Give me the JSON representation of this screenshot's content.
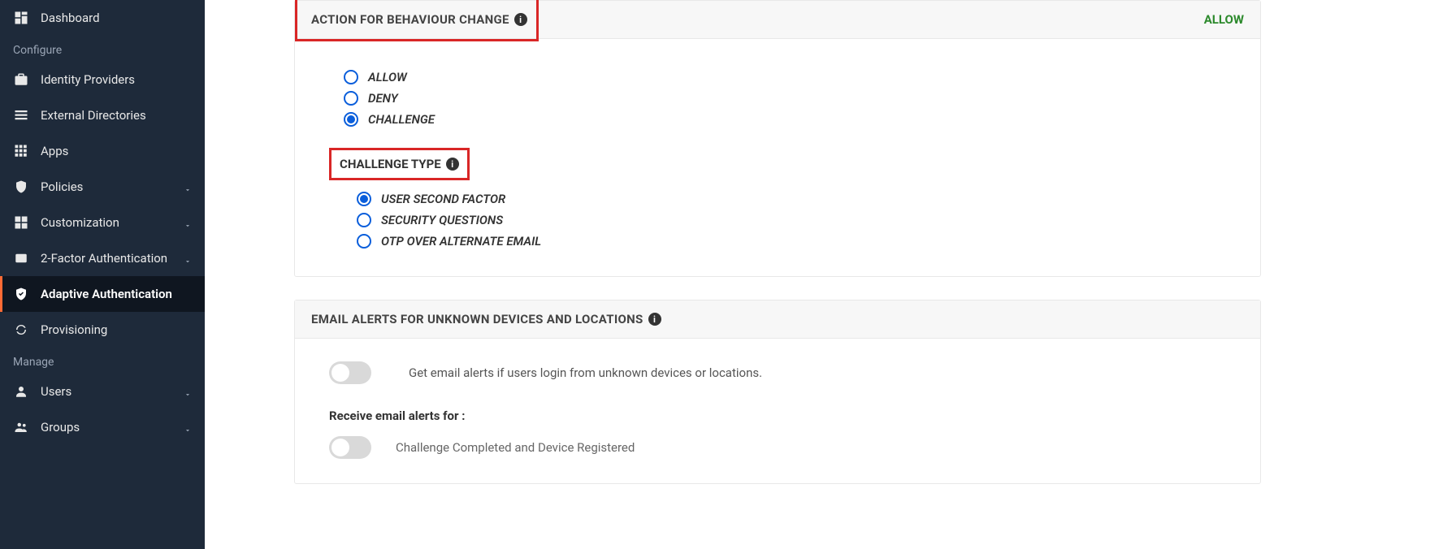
{
  "sidebar": {
    "items": [
      {
        "label": "Dashboard",
        "icon": "dashboard"
      }
    ],
    "sections": [
      {
        "label": "Configure",
        "items": [
          {
            "label": "Identity Providers",
            "icon": "idp"
          },
          {
            "label": "External Directories",
            "icon": "dir"
          },
          {
            "label": "Apps",
            "icon": "apps"
          },
          {
            "label": "Policies",
            "icon": "shield",
            "chev": true
          },
          {
            "label": "Customization",
            "icon": "custom",
            "chev": true
          },
          {
            "label": "2-Factor Authentication",
            "icon": "2fa",
            "chev": true
          },
          {
            "label": "Adaptive Authentication",
            "icon": "adaptive",
            "active": true
          },
          {
            "label": "Provisioning",
            "icon": "prov"
          }
        ]
      },
      {
        "label": "Manage",
        "items": [
          {
            "label": "Users",
            "icon": "user",
            "chev": true
          },
          {
            "label": "Groups",
            "icon": "group",
            "chev": true
          }
        ]
      }
    ]
  },
  "panel1": {
    "title": "ACTION FOR BEHAVIOUR CHANGE",
    "status": "ALLOW",
    "radios": {
      "opt0": "ALLOW",
      "opt1": "DENY",
      "opt2": "CHALLENGE"
    },
    "challenge_title": "CHALLENGE TYPE",
    "challenge": {
      "opt0": "USER SECOND FACTOR",
      "opt1": "SECURITY QUESTIONS",
      "opt2": "OTP OVER ALTERNATE EMAIL"
    }
  },
  "panel2": {
    "title": "EMAIL ALERTS FOR UNKNOWN DEVICES AND LOCATIONS",
    "toggle_text": "Get email alerts if users login from unknown devices or locations.",
    "receive_label": "Receive email alerts for :",
    "item0": "Challenge Completed and Device Registered"
  }
}
